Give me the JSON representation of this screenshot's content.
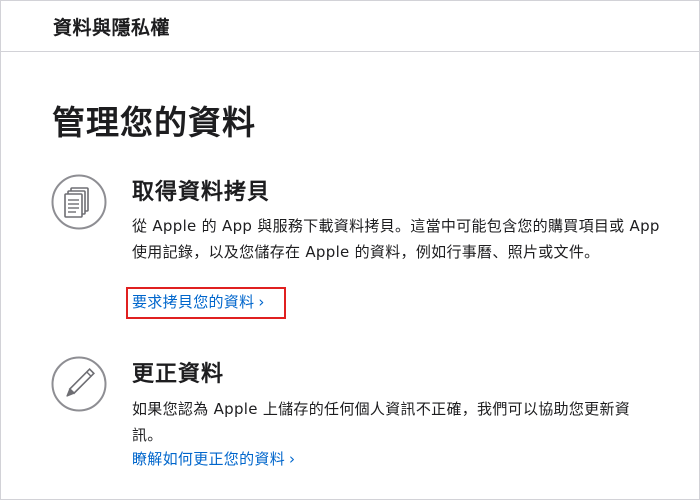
{
  "header": {
    "title": "資料與隱私權"
  },
  "page": {
    "title": "管理您的資料"
  },
  "sections": [
    {
      "icon": "documents-icon",
      "title": "取得資料拷貝",
      "description": "從 Apple 的 App 與服務下載資料拷貝。這當中可能包含您的購買項目或 App 使用記錄，以及您儲存在 Apple 的資料，例如行事曆、照片或文件。",
      "link_label": "要求拷貝您的資料",
      "link_chevron": "›"
    },
    {
      "icon": "pencil-icon",
      "title": "更正資料",
      "description": "如果您認為 Apple 上儲存的任何個人資訊不正確，我們可以協助您更新資訊。",
      "link_label": "瞭解如何更正您的資料",
      "link_chevron": "›"
    }
  ],
  "colors": {
    "link": "#0066cc",
    "highlight": "#e02020",
    "icon_stroke": "#8e8e93",
    "text": "#1d1d1f",
    "border": "#d2d2d7"
  }
}
